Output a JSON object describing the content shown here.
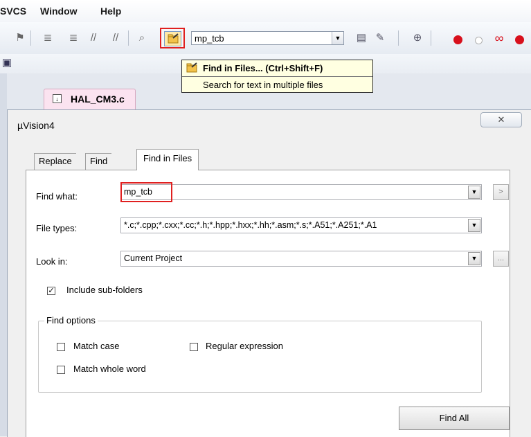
{
  "menu": [
    "SVCS",
    "Window",
    "Help"
  ],
  "toolbar": {
    "search_value": "mp_tcb",
    "find_in_files_icon": "find-in-files-icon"
  },
  "tooltip": {
    "title": "Find in Files... (Ctrl+Shift+F)",
    "description": "Search for text in multiple files"
  },
  "file_tab": {
    "label": "HAL_CM3.c"
  },
  "dialog": {
    "title": "µVision4",
    "close_glyph": "✕",
    "tabs": [
      {
        "label": "Replace",
        "active": false
      },
      {
        "label": "Find",
        "active": false
      },
      {
        "label": "Find in Files",
        "active": true
      }
    ],
    "find_what": {
      "label": "Find what:",
      "value": "mp_tcb",
      "next_glyph": ">"
    },
    "file_types": {
      "label": "File types:",
      "value": "*.c;*.cpp;*.cxx;*.cc;*.h;*.hpp;*.hxx;*.hh;*.asm;*.s;*.A51;*.A251;*.A1"
    },
    "look_in": {
      "label": "Look in:",
      "value": "Current Project",
      "browse_glyph": "..."
    },
    "include_subfolders": {
      "label": "Include sub-folders",
      "checked": true,
      "glyph": "✓"
    },
    "find_options": {
      "label": "Find options",
      "match_case": {
        "label": "Match case",
        "checked": false
      },
      "regular_expression": {
        "label": "Regular expression",
        "checked": false
      },
      "match_whole_word": {
        "label": "Match whole word",
        "checked": false
      }
    },
    "find_all_label": "Find All"
  },
  "colors": {
    "highlight": "#e02020",
    "tooltip_bg": "#ffffe1",
    "file_tab_bg": "#fbe3f0"
  }
}
